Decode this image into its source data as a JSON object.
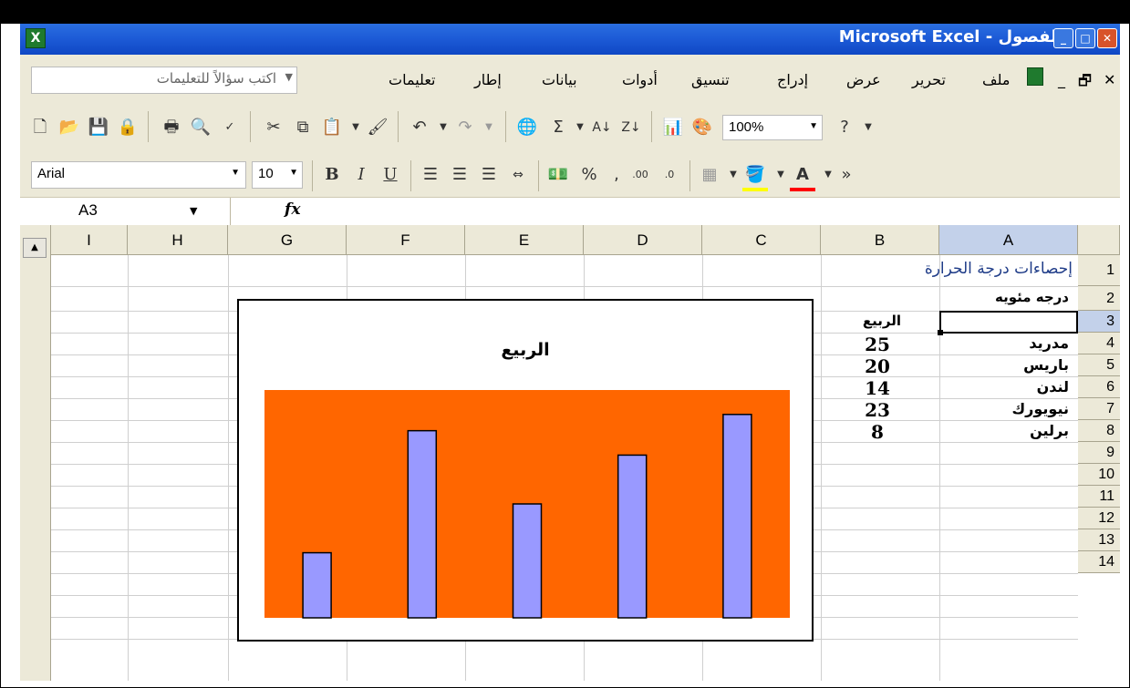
{
  "window": {
    "title": "Microsoft Excel - الفصول",
    "app_icon": "excel-icon",
    "controls": [
      "minimize-icon",
      "maximize-icon",
      "close-icon"
    ]
  },
  "menubar": {
    "doc_controls": [
      "close-icon",
      "restore-icon",
      "minimize-icon"
    ],
    "items": [
      "ملف",
      "تحرير",
      "عرض",
      "إدراج",
      "تنسيق",
      "أدوات",
      "بيانات",
      "إطار",
      "تعليمات"
    ],
    "help_placeholder": "اكتب سؤالاً للتعليمات"
  },
  "toolbar_standard": {
    "icons": [
      "new-icon",
      "open-icon",
      "save-icon",
      "permission-icon",
      "print-icon",
      "print-preview-icon",
      "spelling-icon",
      "cut-icon",
      "copy-icon",
      "paste-icon",
      "format-painter-icon",
      "undo-icon",
      "redo-icon",
      "hyperlink-icon",
      "autosum-icon",
      "sort-ascending-icon",
      "sort-descending-icon",
      "chart-wizard-icon",
      "drawing-icon",
      "help-icon"
    ],
    "zoom": "100%"
  },
  "toolbar_formatting": {
    "font": "Arial",
    "size": "10",
    "icons": [
      "bold-icon",
      "italic-icon",
      "underline-icon",
      "align-left-icon",
      "center-icon",
      "align-right-icon",
      "merge-center-icon",
      "currency-icon",
      "percent-icon",
      "comma-icon",
      "increase-decimal-icon",
      "decrease-decimal-icon",
      "borders-icon",
      "fill-color-icon",
      "font-color-icon",
      "toolbar-options-icon"
    ]
  },
  "formula_bar": {
    "name_box": "A3",
    "fx_label": "fx",
    "content": ""
  },
  "sheet": {
    "columns": [
      "I",
      "H",
      "G",
      "F",
      "E",
      "D",
      "C",
      "B",
      "A"
    ],
    "rows": [
      "1",
      "2",
      "3",
      "4",
      "5",
      "6",
      "7",
      "8",
      "9",
      "10",
      "11",
      "12",
      "13",
      "14"
    ],
    "a1": "إحصاءات درجة الحرارة",
    "a2": "درجه مئويه",
    "b3": "الربيع",
    "cities": [
      "مدريد",
      "باريس",
      "لندن",
      "نيويورك",
      "برلين"
    ],
    "values": [
      "25",
      "20",
      "14",
      "23",
      "8"
    ],
    "selected_cell": "A3"
  },
  "chart_data": {
    "type": "bar",
    "title": "الربيع",
    "categories": [
      "مدريد",
      "باريس",
      "لندن",
      "نيويورك",
      "برلين"
    ],
    "values": [
      8,
      23,
      14,
      20,
      25
    ],
    "ylim": [
      0,
      28
    ],
    "plot_color": "#ff6600",
    "bar_color": "#9999ff",
    "grid": false,
    "legend": "none"
  }
}
